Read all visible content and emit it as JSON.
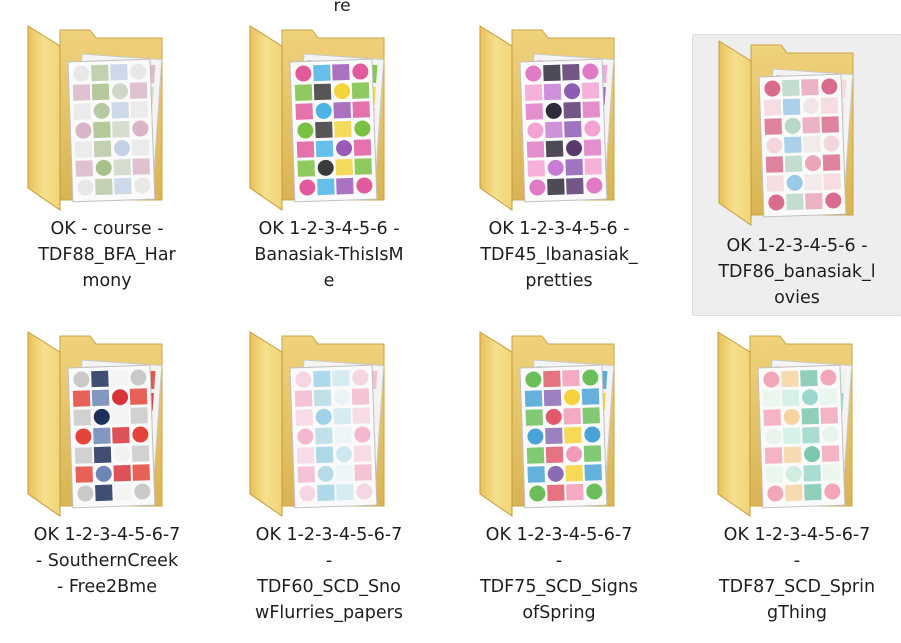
{
  "top_fragment": "re",
  "folders": [
    {
      "name": "OK - course -\nTDF88_BFA_Har\nmony",
      "selected": false,
      "thumb": "doc"
    },
    {
      "name": "OK 1-2-3-4-5-6 -\nBanasiak-ThisIsM\ne",
      "selected": false,
      "thumb": "colorful"
    },
    {
      "name": "OK 1-2-3-4-5-6 -\nTDF45_lbanasiak_\npretties",
      "selected": false,
      "thumb": "purple"
    },
    {
      "name": "OK 1-2-3-4-5-6 -\nTDF86_banasiak_l\novies",
      "selected": true,
      "thumb": "pink"
    },
    {
      "name": "OK 1-2-3-4-5-6-7\n-  SouthernCreek\n- Free2Bme",
      "selected": false,
      "thumb": "navy"
    },
    {
      "name": "OK 1-2-3-4-5-6-7\n-\nTDF60_SCD_Sno\nwFlurries_papers",
      "selected": false,
      "thumb": "snow"
    },
    {
      "name": "OK 1-2-3-4-5-6-7\n-\nTDF75_SCD_Signs\nofSpring",
      "selected": false,
      "thumb": "spring"
    },
    {
      "name": "OK 1-2-3-4-5-6-7\n-\nTDF87_SCD_Sprin\ngThing",
      "selected": false,
      "thumb": "mint"
    }
  ],
  "icons": {
    "folder": "folder-icon"
  },
  "colors": {
    "folder_back": "#e7c86a",
    "folder_front": "#f3dc7c",
    "selection": "#eeeeee"
  }
}
